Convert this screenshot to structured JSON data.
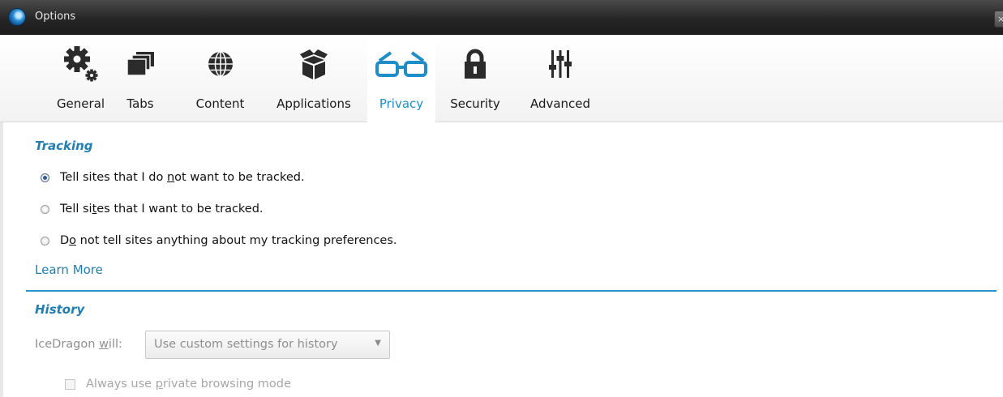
{
  "window": {
    "title": "Options",
    "close_symbol": "×"
  },
  "toolbar": {
    "tabs": [
      {
        "label": "General",
        "icon": "gears-icon"
      },
      {
        "label": "Tabs",
        "icon": "tabs-icon"
      },
      {
        "label": "Content",
        "icon": "globe-icon"
      },
      {
        "label": "Applications",
        "icon": "box-icon"
      },
      {
        "label": "Privacy",
        "icon": "glasses-icon",
        "selected": true
      },
      {
        "label": "Security",
        "icon": "lock-icon"
      },
      {
        "label": "Advanced",
        "icon": "sliders-icon"
      }
    ]
  },
  "tracking": {
    "title": "Tracking",
    "options": [
      {
        "before": "Tell sites that I do ",
        "key": "n",
        "after": "ot want to be tracked.",
        "checked": true
      },
      {
        "before": "Tell si",
        "key": "t",
        "after": "es that I want to be tracked.",
        "checked": false
      },
      {
        "before": "D",
        "key": "o",
        "after": " not tell sites anything about my tracking preferences.",
        "checked": false
      }
    ],
    "learn_more": "Learn More"
  },
  "history": {
    "title": "History",
    "label_before": "IceDragon ",
    "label_key": "w",
    "label_after": "ill:",
    "select_value": "Use custom settings for history",
    "private_before": "Always use ",
    "private_key": "p",
    "private_after": "rivate browsing mode"
  },
  "colors": {
    "accent": "#1f7fb4",
    "selected_tab": "#1f8dc8",
    "divider": "#2a93c9",
    "titlebar": "#262626"
  }
}
